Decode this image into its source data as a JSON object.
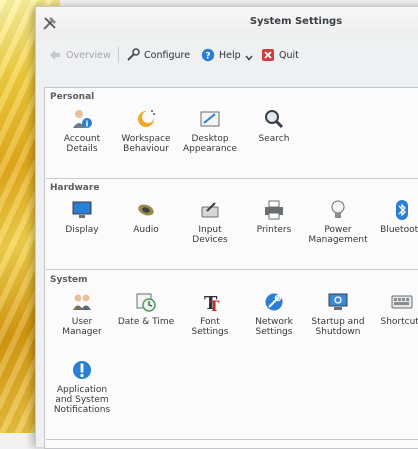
{
  "window": {
    "title": "System Settings"
  },
  "toolbar": {
    "overview": "Overview",
    "configure": "Configure",
    "help": "Help",
    "quit": "Quit"
  },
  "sections": {
    "personal": {
      "title": "Personal",
      "items": [
        "Account\nDetails",
        "Workspace\nBehaviour",
        "Desktop\nAppearance",
        "Search"
      ]
    },
    "hardware": {
      "title": "Hardware",
      "items": [
        "Display",
        "Audio",
        "Input\nDevices",
        "Printers",
        "Power\nManagement",
        "Bluetooth"
      ]
    },
    "system": {
      "title": "System",
      "items": [
        "User\nManager",
        "Date & Time",
        "Font\nSettings",
        "Network\nSettings",
        "Startup and\nShutdown",
        "Shortcuts",
        "Application\nand System\nNotifications"
      ]
    }
  },
  "colors": {
    "accent": "#2a7fd4",
    "quit": "#d23c3c",
    "wallpaper": "#e6ad1c"
  }
}
